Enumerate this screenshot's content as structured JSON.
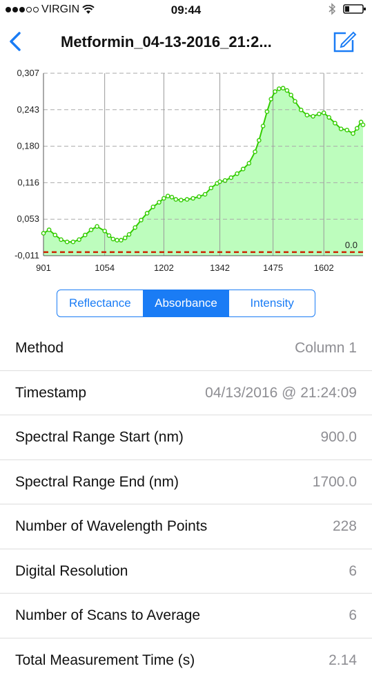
{
  "status_bar": {
    "carrier": "VIRGIN",
    "time": "09:44"
  },
  "nav": {
    "title": "Metformin_04-13-2016_21:2..."
  },
  "chart_data": {
    "type": "line",
    "y_ticks": [
      "0,307",
      "0,243",
      "0,180",
      "0,116",
      "0,053",
      "-0,011"
    ],
    "x_ticks": [
      "901",
      "1054",
      "1202",
      "1342",
      "1475",
      "1602"
    ],
    "xlim": [
      901,
      1700
    ],
    "ylim": [
      -0.011,
      0.307
    ],
    "baseline_label": "0.0",
    "baseline_value": 0.0,
    "fill_color": "#bdfdbd",
    "line_color": "#33cc00",
    "baseline_color": "#cc2200",
    "x": [
      901,
      915,
      930,
      945,
      960,
      975,
      990,
      1005,
      1020,
      1035,
      1054,
      1065,
      1075,
      1085,
      1095,
      1105,
      1115,
      1130,
      1145,
      1160,
      1175,
      1190,
      1202,
      1212,
      1222,
      1232,
      1245,
      1260,
      1275,
      1290,
      1305,
      1320,
      1335,
      1342,
      1355,
      1370,
      1385,
      1400,
      1415,
      1430,
      1440,
      1450,
      1460,
      1470,
      1480,
      1490,
      1500,
      1510,
      1520,
      1530,
      1545,
      1560,
      1575,
      1590,
      1602,
      1615,
      1630,
      1645,
      1660,
      1675,
      1685,
      1695,
      1700
    ],
    "y": [
      0.028,
      0.034,
      0.025,
      0.017,
      0.013,
      0.013,
      0.017,
      0.025,
      0.034,
      0.04,
      0.032,
      0.024,
      0.018,
      0.016,
      0.016,
      0.02,
      0.026,
      0.038,
      0.051,
      0.063,
      0.074,
      0.082,
      0.089,
      0.093,
      0.091,
      0.087,
      0.086,
      0.087,
      0.089,
      0.092,
      0.096,
      0.107,
      0.115,
      0.118,
      0.12,
      0.125,
      0.132,
      0.14,
      0.15,
      0.17,
      0.19,
      0.215,
      0.24,
      0.262,
      0.275,
      0.28,
      0.281,
      0.277,
      0.269,
      0.258,
      0.243,
      0.234,
      0.232,
      0.236,
      0.238,
      0.23,
      0.22,
      0.21,
      0.208,
      0.202,
      0.211,
      0.222,
      0.217
    ]
  },
  "segments": [
    "Reflectance",
    "Absorbance",
    "Intensity"
  ],
  "rows": [
    {
      "label": "Method",
      "value": "Column 1"
    },
    {
      "label": "Timestamp",
      "value": "04/13/2016 @ 21:24:09"
    },
    {
      "label": "Spectral Range Start (nm)",
      "value": "900.0"
    },
    {
      "label": "Spectral Range End (nm)",
      "value": "1700.0"
    },
    {
      "label": "Number of Wavelength Points",
      "value": "228"
    },
    {
      "label": "Digital Resolution",
      "value": "6"
    },
    {
      "label": "Number of Scans to Average",
      "value": "6"
    },
    {
      "label": "Total Measurement Time (s)",
      "value": "2.14"
    }
  ]
}
